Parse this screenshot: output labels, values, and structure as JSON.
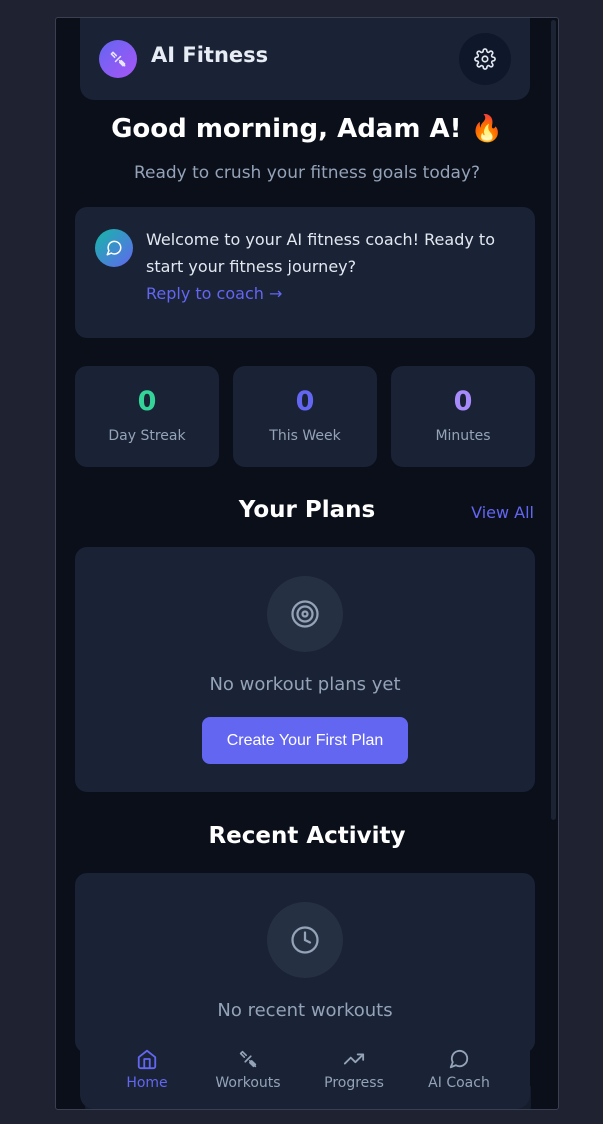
{
  "header": {
    "app_title": "AI Fitness"
  },
  "greeting": {
    "title": "Good morning, Adam A! 🔥",
    "subtitle": "Ready to crush your fitness goals today?"
  },
  "coach_card": {
    "message": "Welcome to your AI fitness coach! Ready to start your fitness journey?",
    "reply_link": "Reply to coach →"
  },
  "stats": [
    {
      "value": "0",
      "label": "Day Streak",
      "color": "#34d399"
    },
    {
      "value": "0",
      "label": "This Week",
      "color": "#6366f1"
    },
    {
      "value": "0",
      "label": "Minutes",
      "color": "#a78bfa"
    }
  ],
  "plans": {
    "title": "Your Plans",
    "view_all": "View All",
    "empty_text": "No workout plans yet",
    "create_button": "Create Your First Plan"
  },
  "activity": {
    "title": "Recent Activity",
    "empty_text": "No recent workouts"
  },
  "nav": [
    {
      "label": "Home",
      "icon": "home-icon",
      "active": true
    },
    {
      "label": "Workouts",
      "icon": "dumbbell-icon",
      "active": false
    },
    {
      "label": "Progress",
      "icon": "trending-up-icon",
      "active": false
    },
    {
      "label": "AI Coach",
      "icon": "chat-bubble-icon",
      "active": false
    }
  ],
  "colors": {
    "accent": "#6366f1",
    "background": "#0a0f1a",
    "card": "#1a2235"
  }
}
